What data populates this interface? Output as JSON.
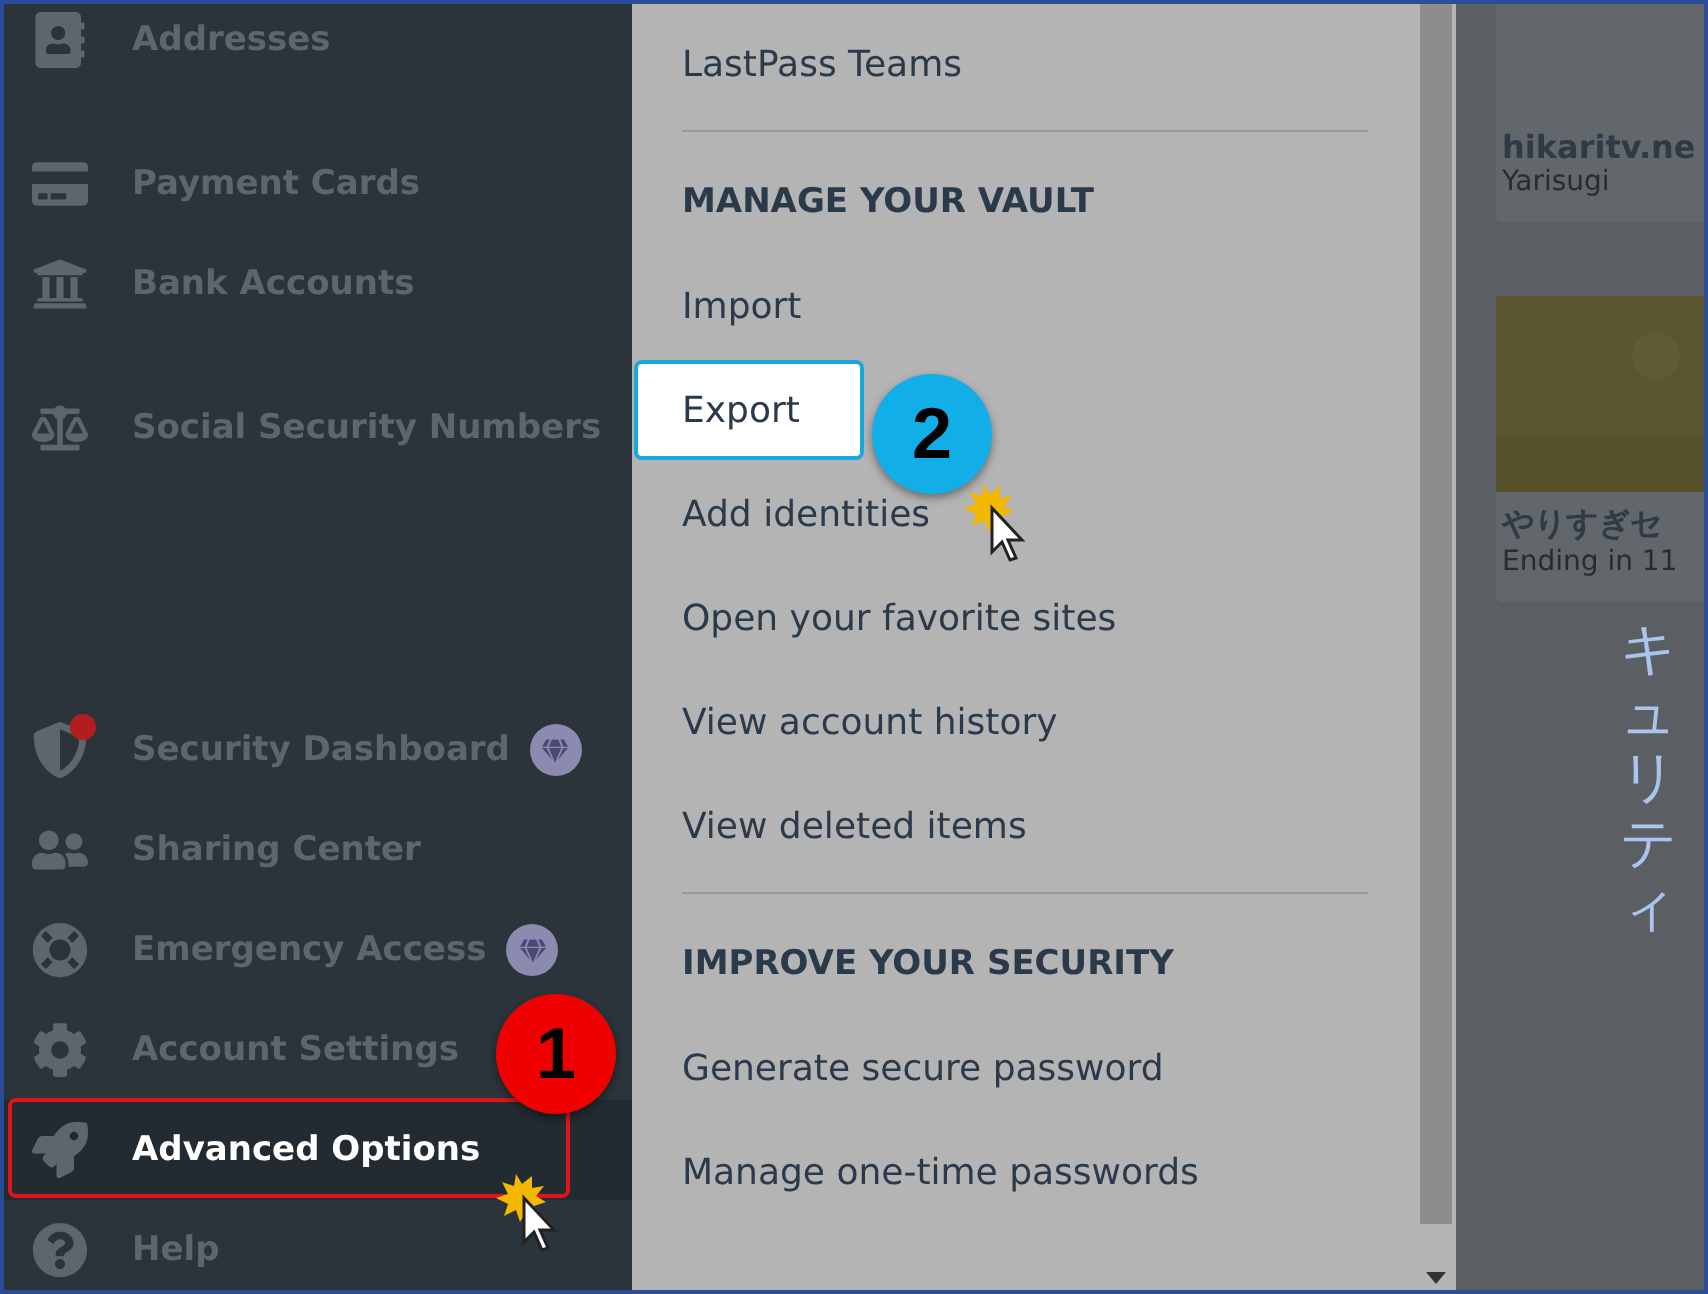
{
  "sidebar": {
    "groups": [
      [
        {
          "label": "Addresses",
          "selected": false,
          "premium": false,
          "alert": false
        }
      ],
      [
        {
          "label": "Payment Cards",
          "selected": false,
          "premium": false,
          "alert": false
        },
        {
          "label": "Bank Accounts",
          "selected": false,
          "premium": false,
          "alert": false
        }
      ],
      [
        {
          "label": "Social Security Numbers",
          "selected": false,
          "premium": false,
          "alert": false
        }
      ]
    ],
    "bottom_items": [
      {
        "label": "Security Dashboard",
        "selected": false,
        "premium": true,
        "alert": true
      },
      {
        "label": "Sharing Center",
        "selected": false,
        "premium": false,
        "alert": false
      },
      {
        "label": "Emergency Access",
        "selected": false,
        "premium": true,
        "alert": false
      },
      {
        "label": "Account Settings",
        "selected": false,
        "premium": false,
        "alert": false
      },
      {
        "label": "Advanced Options",
        "selected": true,
        "premium": false,
        "alert": false,
        "callout": "1"
      },
      {
        "label": "Help",
        "selected": false,
        "premium": false,
        "alert": false
      }
    ]
  },
  "menu": {
    "top_item": {
      "label": "LastPass Teams"
    },
    "sections": [
      {
        "heading": "MANAGE YOUR VAULT",
        "items": [
          {
            "label": "Import",
            "selected": false
          },
          {
            "label": "Export",
            "selected": true,
            "callout": "2"
          },
          {
            "label": "Add identities",
            "selected": false
          },
          {
            "label": "Open your favorite sites",
            "selected": false
          },
          {
            "label": "View account history",
            "selected": false
          },
          {
            "label": "View deleted items",
            "selected": false
          }
        ]
      },
      {
        "heading": "IMPROVE YOUR SECURITY",
        "items": [
          {
            "label": "Generate secure password",
            "selected": false
          },
          {
            "label": "Manage one-time passwords",
            "selected": false
          }
        ]
      }
    ]
  },
  "content": {
    "cards": [
      {
        "kind": "site",
        "title": "hikaritv.ne",
        "subtitle": "Yarisugi"
      },
      {
        "kind": "picture",
        "title": "やりすぎセ",
        "subtitle": "Ending in 11"
      }
    ],
    "vertical_text": "キュリティ"
  }
}
